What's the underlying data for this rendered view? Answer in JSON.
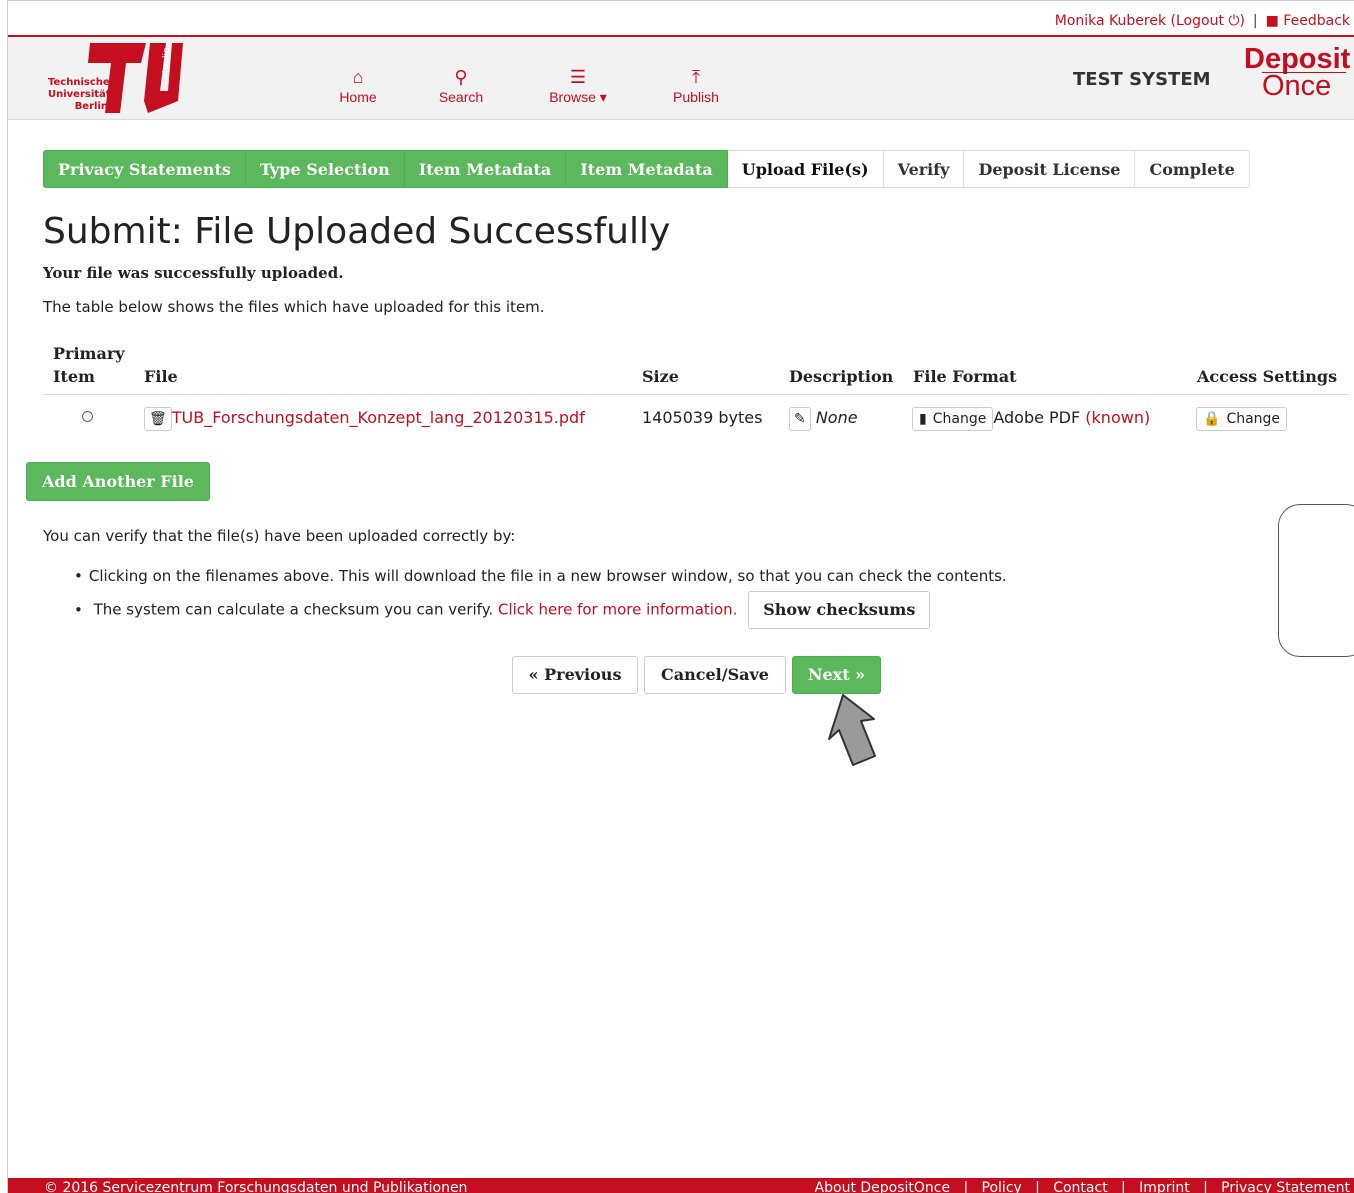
{
  "userbar": {
    "user": "Monika Kuberek",
    "logout": "(Logout ⏻)",
    "separator": "|",
    "feedback": "Feedback"
  },
  "header": {
    "logo_text": "Technische\nUniversität\nBerlin",
    "logo_side": "berlin",
    "nav": [
      {
        "label": "Home",
        "icon": "home-icon"
      },
      {
        "label": "Search",
        "icon": "search-icon"
      },
      {
        "label": "Browse ▾",
        "icon": "list-icon"
      },
      {
        "label": "Publish",
        "icon": "upload-circle-icon"
      }
    ],
    "test_system": "TEST SYSTEM",
    "brand_top": "Deposit",
    "brand_bottom": "Once"
  },
  "steps": [
    {
      "label": "Privacy Statements",
      "state": "done"
    },
    {
      "label": "Type Selection",
      "state": "done"
    },
    {
      "label": "Item Metadata",
      "state": "done"
    },
    {
      "label": "Item Metadata",
      "state": "done"
    },
    {
      "label": "Upload File(s)",
      "state": "current"
    },
    {
      "label": "Verify",
      "state": "todo"
    },
    {
      "label": "Deposit License",
      "state": "todo"
    },
    {
      "label": "Complete",
      "state": "todo"
    }
  ],
  "page": {
    "title": "Submit: File Uploaded Successfully",
    "lead_bold": "Your file was successfully uploaded.",
    "lead": "The table below shows the files which have uploaded for this item."
  },
  "table": {
    "headers": {
      "primary_line1": "Primary",
      "primary_line2": "Item",
      "file": "File",
      "size": "Size",
      "description": "Description",
      "format": "File Format",
      "access": "Access Settings"
    },
    "row": {
      "file_name": "TUB_Forschungsdaten_Konzept_lang_20120315.pdf",
      "size": "1405039 bytes",
      "description": "None",
      "format_change": "Change",
      "format": "Adobe PDF",
      "format_known": "(known)",
      "access_change": "Change"
    }
  },
  "add_file": "Add Another File",
  "verify": {
    "intro": "You can verify that the file(s) have been uploaded correctly by:",
    "bullet1": "Clicking on the filenames above. This will download the file in a new browser window, so that you can check the contents.",
    "bullet2": "The system can calculate a checksum you can verify.",
    "bullet2_link": "Click here for more information.",
    "checksum_button": "Show checksums"
  },
  "nav_buttons": {
    "previous": "« Previous",
    "cancel": "Cancel/Save",
    "next": "Next »"
  },
  "footer": {
    "copyright": "© 2016 Servicezentrum Forschungsdaten und Publikationen",
    "links": "About DepositOnce   |   Policy   |   Contact   |   Imprint   |   Privacy Statement"
  },
  "colors": {
    "brand_red": "#c50e1f",
    "success_green": "#5cb85c"
  }
}
